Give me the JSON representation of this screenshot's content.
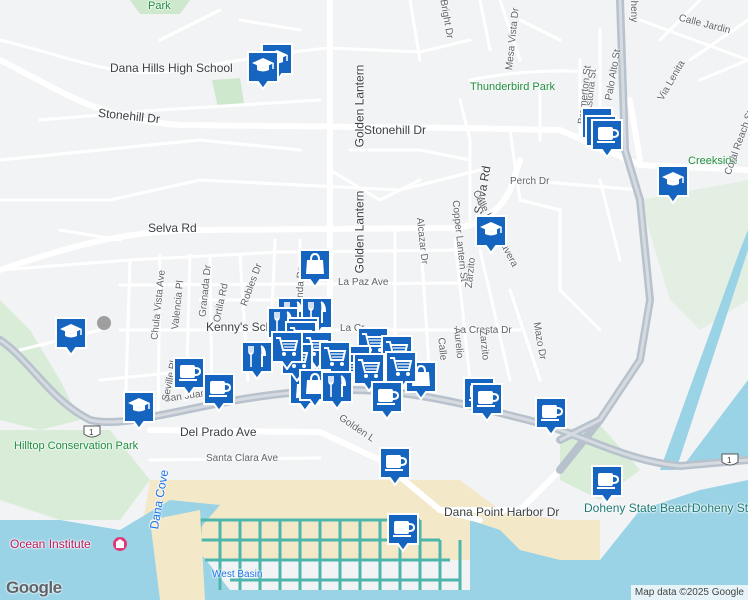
{
  "map": {
    "attribution": "Map data ©2025 Google",
    "logo": "Google"
  },
  "labels": {
    "streets": [
      "Stonehill Dr",
      "Stonehill Dr",
      "Selva Rd",
      "Selva Rd",
      "Golden Lantern",
      "Golden Lantern",
      "La Paz Ave",
      "Del Prado Ave",
      "Santa Clara Ave",
      "Dana Point Harbor Dr",
      "Perch Dr",
      "La Cresta Dr",
      "Calle Jardin",
      "Via Lenita",
      "Coral Reach St",
      "Palo Alto St",
      "Astoria St",
      "Bremerton St",
      "Sea Bright Dr",
      "Mesa Vista Dr",
      "Copper Lantern St",
      "Alcazar Dr",
      "Calle La Primavera",
      "Chula Vista Ave",
      "Valencia Pl",
      "Granada Dr",
      "Ortila Rd",
      "Robles Dr",
      "Olinda Dr",
      "Zarzito",
      "Mazo Dr",
      "San Juan",
      "Golden L",
      "Aurelio",
      "Calle",
      "Zarzito",
      "Seville Pl",
      "La Cr",
      "Doheny"
    ],
    "places": {
      "school": "Dana Hills High School",
      "kennys": "Kenny's School and",
      "thunderbird": "Thunderbird Park",
      "creekside": "Creekside",
      "hilltop": "Hilltop Conservation Park",
      "ocean_institute": "Ocean Institute",
      "dana_cove": "Dana Cove",
      "west_basin": "West Basin",
      "doheny_beach": "Doheny State Beach",
      "doheny_camp": "Doheny State Beach Campground",
      "park_top": "Park"
    },
    "highway_shield": "1"
  },
  "markers": {
    "icon_types": [
      "school-icon",
      "coffee-icon",
      "shopping-bag-icon",
      "shopping-cart-icon",
      "restaurant-icon"
    ],
    "count": 40
  },
  "colors": {
    "land": "#f2f3f4",
    "road": "#ffffff",
    "highway": "#b8c2cc",
    "water": "#9ad3e6",
    "park": "#cde8cd",
    "sand": "#f3e9c9",
    "marker": "#1565c0"
  }
}
